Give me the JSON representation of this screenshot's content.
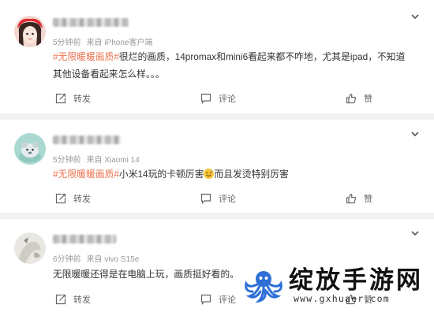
{
  "comments": [
    {
      "meta_time": "5分钟前",
      "meta_source": "来自 iPhone客户端",
      "tag": "#无限暖暖画质#",
      "text": "很烂的画质，14promax和mini6看起来都不咋地，尤其是ipad，不知道其他设备看起来怎么样。。。",
      "repost": "转发",
      "comment": "评论",
      "like": "赞"
    },
    {
      "meta_time": "5分钟前",
      "meta_source": "来自 Xiaomi 14",
      "tag": "#无限暖暖画质#",
      "text_before_emoji": "小米14玩的卡顿厉害",
      "text_after_emoji": "而且发烫特别厉害",
      "repost": "转发",
      "comment": "评论",
      "like": "赞"
    },
    {
      "meta_time": "6分钟前",
      "meta_source": "来自 vivo S15e",
      "text": "无限暖暖还得是在电脑上玩，画质挺好看的。",
      "repost": "转发",
      "comment": "评论",
      "like": "赞"
    }
  ],
  "watermark": {
    "title": "绽放手游网",
    "url": "www.gxhuaer.com"
  },
  "colors": {
    "tag": "#eb7350",
    "meta": "#999999",
    "background": "#f2f2f2"
  }
}
